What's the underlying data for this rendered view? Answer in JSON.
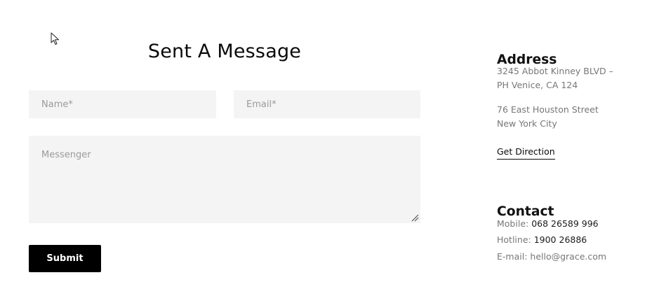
{
  "form": {
    "title": "Sent A Message",
    "name_placeholder": "Name*",
    "email_placeholder": "Email*",
    "message_placeholder": "Messenger",
    "submit_label": "Submit"
  },
  "address": {
    "heading": "Address",
    "line1a": "3245 Abbot Kinney BLVD –",
    "line1b": "PH Venice, CA 124",
    "line2a": "76 East Houston Street",
    "line2b": "New York City",
    "direction_label": "Get Direction"
  },
  "contact": {
    "heading": "Contact",
    "mobile_label": "Mobile: ",
    "mobile_value": "068 26589 996",
    "hotline_label": "Hotline: ",
    "hotline_value": "1900 26886",
    "email_label": "E-mail: ",
    "email_value": "hello@grace.com"
  },
  "icons": {
    "cursor": "mouse-pointer-icon",
    "resize": "resize-grip-icon"
  }
}
